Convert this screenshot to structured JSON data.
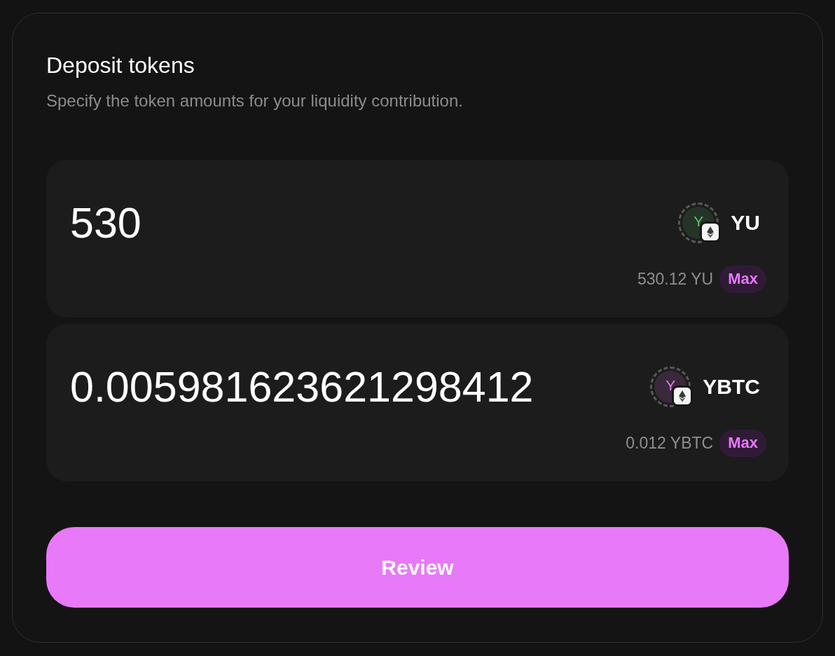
{
  "header": {
    "title": "Deposit tokens",
    "subtitle": "Specify the token amounts for your liquidity contribution."
  },
  "token_inputs": [
    {
      "amount": "530",
      "token": {
        "icon_letter": "Y",
        "color": "#5cc466",
        "symbol": "YU"
      },
      "balance": "530.12 YU",
      "max_button": "Max"
    },
    {
      "amount": "0.005981623621298412",
      "token": {
        "icon_letter": "Y",
        "color": "#e879f9",
        "symbol": "YBTC"
      },
      "balance": "0.012 YBTC",
      "max_button": "Max"
    }
  ],
  "review_button": "Review"
}
